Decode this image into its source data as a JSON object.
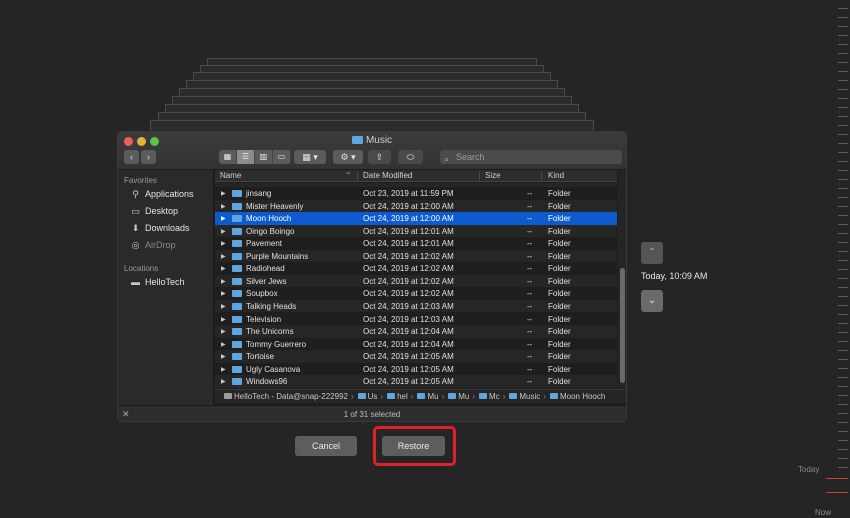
{
  "window": {
    "title": "Music"
  },
  "toolbar": {
    "search_placeholder": "Search",
    "gear_symbol": "⚙",
    "view_icons": [
      "grid-view-icon",
      "list-view-icon",
      "column-view-icon",
      "gallery-view-icon"
    ]
  },
  "sidebar": {
    "favorites_header": "Favorites",
    "favorites": [
      {
        "label": "Applications",
        "icon": "applications-icon"
      },
      {
        "label": "Desktop",
        "icon": "desktop-icon"
      },
      {
        "label": "Downloads",
        "icon": "downloads-icon"
      },
      {
        "label": "AirDrop",
        "icon": "airdrop-icon"
      }
    ],
    "locations_header": "Locations",
    "locations": [
      {
        "label": "HelloTech",
        "icon": "drive-icon"
      }
    ]
  },
  "columns": {
    "name": "Name",
    "date": "Date Modified",
    "size": "Size",
    "kind": "Kind"
  },
  "rows": [
    {
      "name": "jinsang",
      "date": "Oct 23, 2019 at 11:59 PM",
      "size": "--",
      "kind": "Folder"
    },
    {
      "name": "Mister Heavenly",
      "date": "Oct 24, 2019 at 12:00 AM",
      "size": "--",
      "kind": "Folder"
    },
    {
      "name": "Moon Hooch",
      "date": "Oct 24, 2019 at 12:00 AM",
      "size": "--",
      "kind": "Folder",
      "selected": true
    },
    {
      "name": "Oingo Boingo",
      "date": "Oct 24, 2019 at 12:01 AM",
      "size": "--",
      "kind": "Folder"
    },
    {
      "name": "Pavement",
      "date": "Oct 24, 2019 at 12:01 AM",
      "size": "--",
      "kind": "Folder"
    },
    {
      "name": "Purple Mountains",
      "date": "Oct 24, 2019 at 12:02 AM",
      "size": "--",
      "kind": "Folder"
    },
    {
      "name": "Radiohead",
      "date": "Oct 24, 2019 at 12:02 AM",
      "size": "--",
      "kind": "Folder"
    },
    {
      "name": "Silver Jews",
      "date": "Oct 24, 2019 at 12:02 AM",
      "size": "--",
      "kind": "Folder"
    },
    {
      "name": "Soupbox",
      "date": "Oct 24, 2019 at 12:02 AM",
      "size": "--",
      "kind": "Folder"
    },
    {
      "name": "Talking Heads",
      "date": "Oct 24, 2019 at 12:03 AM",
      "size": "--",
      "kind": "Folder"
    },
    {
      "name": "Television",
      "date": "Oct 24, 2019 at 12:03 AM",
      "size": "--",
      "kind": "Folder"
    },
    {
      "name": "The Unicorns",
      "date": "Oct 24, 2019 at 12:04 AM",
      "size": "--",
      "kind": "Folder"
    },
    {
      "name": "Tommy Guerrero",
      "date": "Oct 24, 2019 at 12:04 AM",
      "size": "--",
      "kind": "Folder"
    },
    {
      "name": "Tortoise",
      "date": "Oct 24, 2019 at 12:05 AM",
      "size": "--",
      "kind": "Folder"
    },
    {
      "name": "Ugly Casanova",
      "date": "Oct 24, 2019 at 12:05 AM",
      "size": "--",
      "kind": "Folder"
    },
    {
      "name": "Windows96",
      "date": "Oct 24, 2019 at 12:05 AM",
      "size": "--",
      "kind": "Folder"
    }
  ],
  "pathbar": {
    "segments": [
      "HelloTech - Data@snap-222992",
      "Us",
      "hel",
      "Mu",
      "Mu",
      "Mc",
      "Music",
      "Moon Hooch"
    ]
  },
  "status": {
    "selection_text": "1 of 31 selected"
  },
  "buttons": {
    "cancel": "Cancel",
    "restore": "Restore"
  },
  "timeline": {
    "current_time": "Today, 10:09 AM",
    "today_label": "Today",
    "now_label": "Now"
  },
  "colors": {
    "selection": "#0e5bd0",
    "highlight_box": "#e0202a",
    "folder": "#5ea6dd"
  }
}
